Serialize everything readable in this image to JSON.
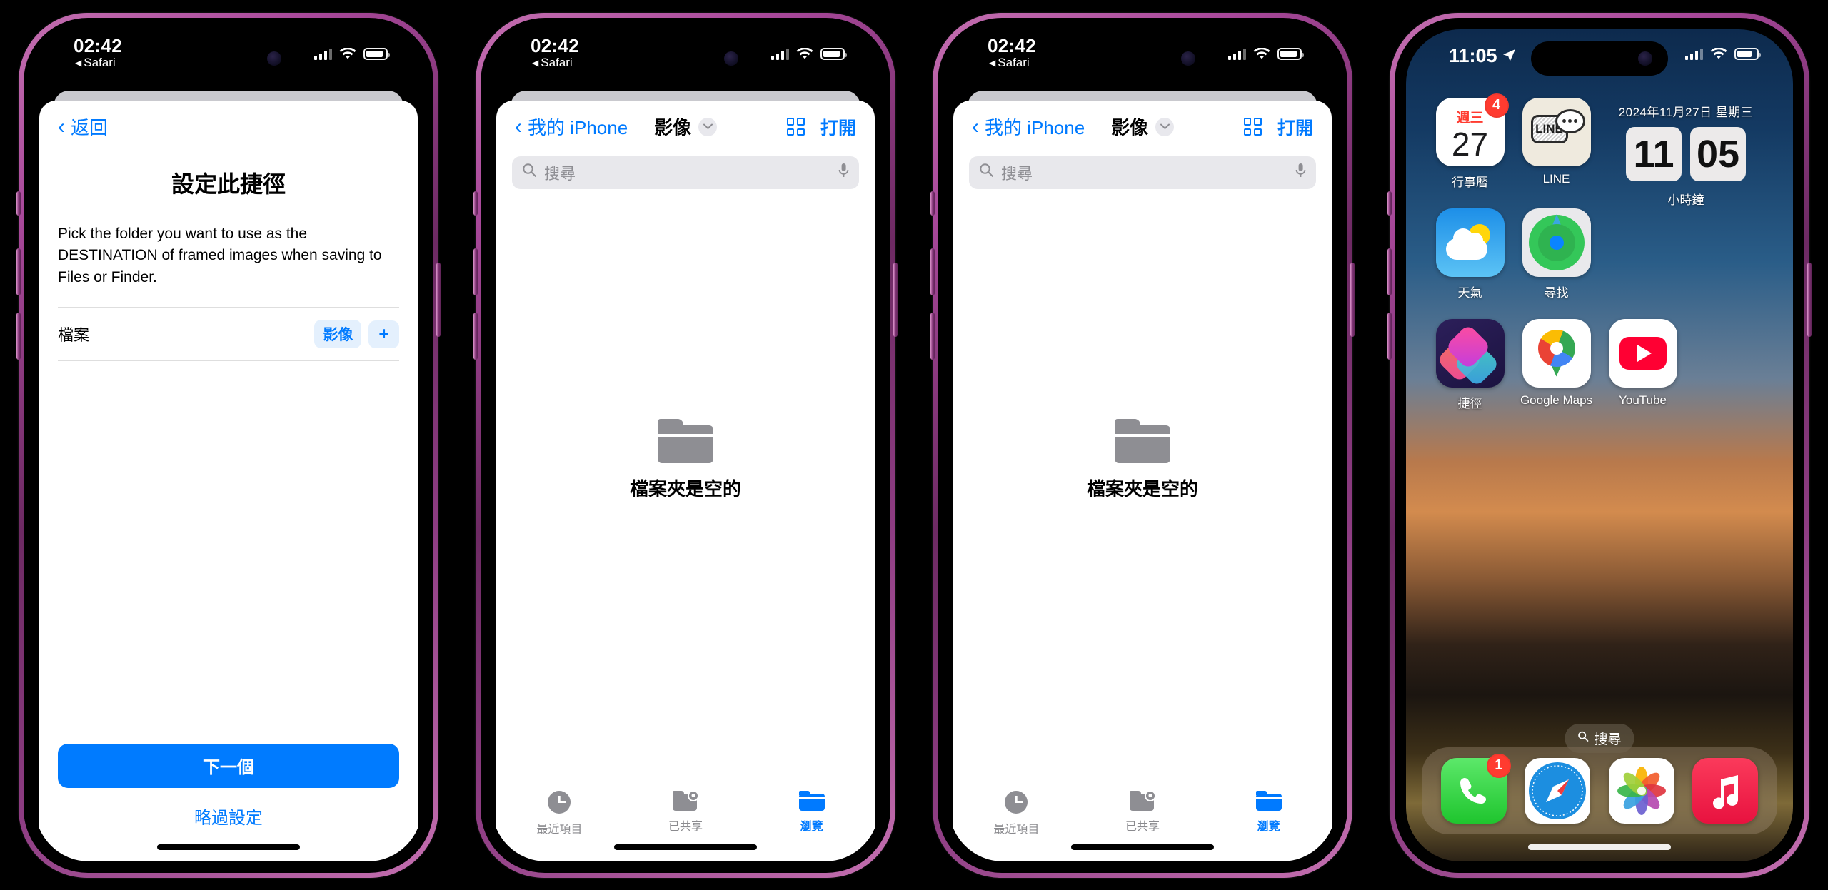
{
  "phone1": {
    "status": {
      "time": "02:42",
      "back_app": "Safari",
      "back_arrow": "◀",
      "battery_pct": 88
    },
    "nav": {
      "back_label": "返回",
      "back_chevron": "‹"
    },
    "title": "設定此捷徑",
    "description": "Pick the folder you want to use as the DESTINATION of framed images when saving to Files or Finder.",
    "row": {
      "label": "檔案",
      "value_pill": "影像",
      "add_pill": "+"
    },
    "primary_button": "下一個",
    "secondary_button": "略過設定"
  },
  "phone2": {
    "status": {
      "time": "02:42",
      "back_app": "Safari",
      "back_arrow": "◀",
      "battery_pct": 88
    },
    "nav": {
      "back_label": "我的 iPhone",
      "back_chevron": "‹",
      "title": "影像",
      "chevron_down": "⌄",
      "open_label": "打開"
    },
    "search": {
      "placeholder": "搜尋",
      "value": ""
    },
    "empty_state": {
      "text": "檔案夾是空的",
      "icon": "folder-icon"
    },
    "tabs": [
      {
        "label": "最近項目",
        "icon": "recents-clock-icon",
        "active": false
      },
      {
        "label": "已共享",
        "icon": "shared-folder-icon",
        "active": false
      },
      {
        "label": "瀏覽",
        "icon": "browse-folder-icon",
        "active": true
      }
    ]
  },
  "phone3": {
    "status": {
      "time": "02:42",
      "back_app": "Safari",
      "back_arrow": "◀",
      "battery_pct": 88
    },
    "nav": {
      "back_label": "我的 iPhone",
      "back_chevron": "‹",
      "title": "影像",
      "chevron_down": "⌄",
      "open_label": "打開"
    },
    "search": {
      "placeholder": "搜尋",
      "value": ""
    },
    "empty_state": {
      "text": "檔案夾是空的",
      "icon": "folder-icon"
    },
    "tabs": [
      {
        "label": "最近項目",
        "icon": "recents-clock-icon",
        "active": false
      },
      {
        "label": "已共享",
        "icon": "shared-folder-icon",
        "active": false
      },
      {
        "label": "瀏覽",
        "icon": "browse-folder-icon",
        "active": true
      }
    ]
  },
  "phone4": {
    "status": {
      "time": "11:05",
      "location_arrow": "➤",
      "battery_pct": 78
    },
    "apps": [
      {
        "name": "行事曆",
        "icon": "calendar-icon",
        "badge": "4",
        "cal_weekday": "週三",
        "cal_day": "27"
      },
      {
        "name": "LINE",
        "icon": "line-icon",
        "badge": "",
        "line_text": "LINE"
      },
      {
        "name": "天氣",
        "icon": "weather-icon",
        "badge": ""
      },
      {
        "name": "尋找",
        "icon": "findmy-icon",
        "badge": ""
      },
      {
        "name": "捷徑",
        "icon": "shortcuts-icon",
        "badge": ""
      },
      {
        "name": "Google Maps",
        "icon": "google-maps-icon",
        "badge": ""
      },
      {
        "name": "YouTube",
        "icon": "youtube-icon",
        "badge": ""
      }
    ],
    "clock_widget": {
      "date": "2024年11月27日 星期三",
      "hours": "11",
      "minutes": "05",
      "name": "小時鐘"
    },
    "search_pill": "搜尋",
    "dock": [
      {
        "name": "phone-app-icon",
        "badge": "1"
      },
      {
        "name": "safari-app-icon",
        "badge": ""
      },
      {
        "name": "photos-app-icon",
        "badge": ""
      },
      {
        "name": "music-app-icon",
        "badge": ""
      }
    ]
  },
  "colors": {
    "accent_blue": "#007aff",
    "frame_purple": "#8e3d83",
    "badge_red": "#ff3b30",
    "pill_bg": "#e4f0fd"
  }
}
